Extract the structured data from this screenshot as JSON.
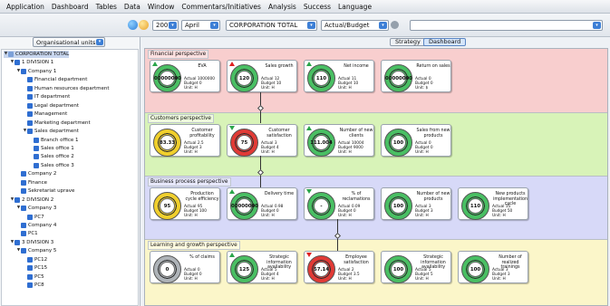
{
  "menu": [
    "Application",
    "Dashboard",
    "Tables",
    "Data",
    "Window",
    "Commentars/Initiatives",
    "Analysis",
    "Success",
    "Language"
  ],
  "toolbar": {
    "year": "2007",
    "month": "April",
    "unit": "CORPORATION TOTAL",
    "view": "Actual/Budget",
    "last": ""
  },
  "left": {
    "org_button": "Organisational units",
    "tree": [
      {
        "label": "CORPORATION TOTAL",
        "level": 0,
        "expanded": true,
        "root": true
      },
      {
        "label": "1 DIVISION 1",
        "level": 1,
        "expanded": true
      },
      {
        "label": "Company 1",
        "level": 2,
        "expanded": true
      },
      {
        "label": "Financial department",
        "level": 3
      },
      {
        "label": "Human resources department",
        "level": 3
      },
      {
        "label": "IT department",
        "level": 3
      },
      {
        "label": "Legal department",
        "level": 3
      },
      {
        "label": "Management",
        "level": 3
      },
      {
        "label": "Marketing department",
        "level": 3
      },
      {
        "label": "Sales department",
        "level": 3,
        "expanded": true
      },
      {
        "label": "Branch office 1",
        "level": 4
      },
      {
        "label": "Sales office 1",
        "level": 4
      },
      {
        "label": "Sales office 2",
        "level": 4
      },
      {
        "label": "Sales office 3",
        "level": 4
      },
      {
        "label": "Company 2",
        "level": 2
      },
      {
        "label": "Finance",
        "level": 2
      },
      {
        "label": "Sekretariat uprave",
        "level": 2
      },
      {
        "label": "2 DIVISION 2",
        "level": 1,
        "expanded": true
      },
      {
        "label": "Company 3",
        "level": 2,
        "expanded": true
      },
      {
        "label": "PC7",
        "level": 3
      },
      {
        "label": "Company 4",
        "level": 2
      },
      {
        "label": "PC1",
        "level": 2
      },
      {
        "label": "3 DIVISION 3",
        "level": 1,
        "expanded": true
      },
      {
        "label": "Company 5",
        "level": 2,
        "expanded": true
      },
      {
        "label": "PC12",
        "level": 3
      },
      {
        "label": "PC15",
        "level": 3
      },
      {
        "label": "PC5",
        "level": 3
      },
      {
        "label": "PC8",
        "level": 3
      }
    ]
  },
  "tabs": [
    "Strategy",
    "Dashboard"
  ],
  "colors": {
    "finance_band": "#f8cece",
    "customers_band": "#d8f3b8",
    "process_band": "#d7d9f8",
    "learning_band": "#fbf6c9",
    "gauge_green": "#49bf63",
    "gauge_red": "#e13a36",
    "gauge_yellow": "#f0cf2c",
    "gauge_grey": "#aeb3b8"
  },
  "perspectives": [
    {
      "label": "Financial perspective",
      "kpis": [
        {
          "title": "EVA",
          "value": "00000000",
          "stats": [
            "Actual 1000000",
            "Budget 0",
            "Unit: H"
          ],
          "gauge": "green",
          "trend": "up"
        },
        {
          "title": "Sales growth",
          "value": "120",
          "stats": [
            "Actual 12",
            "Budget 10",
            "Unit: H"
          ],
          "gauge": "green",
          "trend": "up-red"
        },
        {
          "title": "Net income",
          "value": "110",
          "stats": [
            "Actual 11",
            "Budget 10",
            "Unit: H"
          ],
          "gauge": "green",
          "trend": "up"
        },
        {
          "title": "Return on sales",
          "value": "00000000",
          "stats": [
            "Actual 0",
            "Budget 0",
            "Unit: $"
          ],
          "gauge": "green",
          "trend": ""
        }
      ]
    },
    {
      "label": "Customers perspective",
      "kpis": [
        {
          "title": "Customer profitability",
          "value": "83.33",
          "stats": [
            "Actual 2.5",
            "Budget 3",
            "Unit: H"
          ],
          "gauge": "yellow",
          "trend": ""
        },
        {
          "title": "Customer satisfaction",
          "value": "75",
          "stats": [
            "Actual 3",
            "Budget 4",
            "Unit: H"
          ],
          "gauge": "red",
          "trend": "down"
        },
        {
          "title": "Number of new clients",
          "value": "111.004",
          "stats": [
            "Actual 10004",
            "Budget 9000",
            "Unit: H"
          ],
          "gauge": "green",
          "trend": "up"
        },
        {
          "title": "Sales from new products",
          "value": "100",
          "stats": [
            "Actual 0",
            "Budget 0",
            "Unit: H"
          ],
          "gauge": "green",
          "trend": ""
        }
      ]
    },
    {
      "label": "Business process perspective",
      "kpis": [
        {
          "title": "Production cycle efficiency",
          "value": "95",
          "stats": [
            "Actual 95",
            "Budget 100",
            "Unit: H"
          ],
          "gauge": "yellow",
          "trend": ""
        },
        {
          "title": "Delivery time",
          "value": "00000000",
          "stats": [
            "Actual 0.98",
            "Budget 0",
            "Unit: H"
          ],
          "gauge": "green",
          "trend": "up"
        },
        {
          "title": "% of reclamations",
          "value": "-",
          "stats": [
            "Actual 0.09",
            "Budget 0",
            "Unit: H"
          ],
          "gauge": "green",
          "trend": "down"
        },
        {
          "title": "Number of new products",
          "value": "100",
          "stats": [
            "Actual 3",
            "Budget 3",
            "Unit: H"
          ],
          "gauge": "green",
          "trend": ""
        },
        {
          "title": "New products implementation cycle",
          "value": "110",
          "stats": [
            "Actual 55",
            "Budget 50",
            "Unit: H"
          ],
          "gauge": "green",
          "trend": ""
        }
      ]
    },
    {
      "label": "Learning and growth perspective",
      "kpis": [
        {
          "title": "% of claims",
          "value": "0",
          "stats": [
            "Actual 0",
            "Budget 0",
            "Unit: H"
          ],
          "gauge": "grey",
          "trend": ""
        },
        {
          "title": "Strategic information availability",
          "value": "125",
          "stats": [
            "Actual 5",
            "Budget 4",
            "Unit: H"
          ],
          "gauge": "green",
          "trend": "up"
        },
        {
          "title": "Employee satisfaction",
          "value": "57.14",
          "stats": [
            "Actual 2",
            "Budget 3.5",
            "Unit: H"
          ],
          "gauge": "red",
          "trend": "down-red"
        },
        {
          "title": "Strategic information availability",
          "value": "100",
          "stats": [
            "Actual 5",
            "Budget 5",
            "Unit: H"
          ],
          "gauge": "green",
          "trend": ""
        },
        {
          "title": "Number of realized trainings",
          "value": "100",
          "stats": [
            "Actual 3",
            "Budget 3",
            "Unit: H"
          ],
          "gauge": "green",
          "trend": ""
        }
      ]
    }
  ]
}
